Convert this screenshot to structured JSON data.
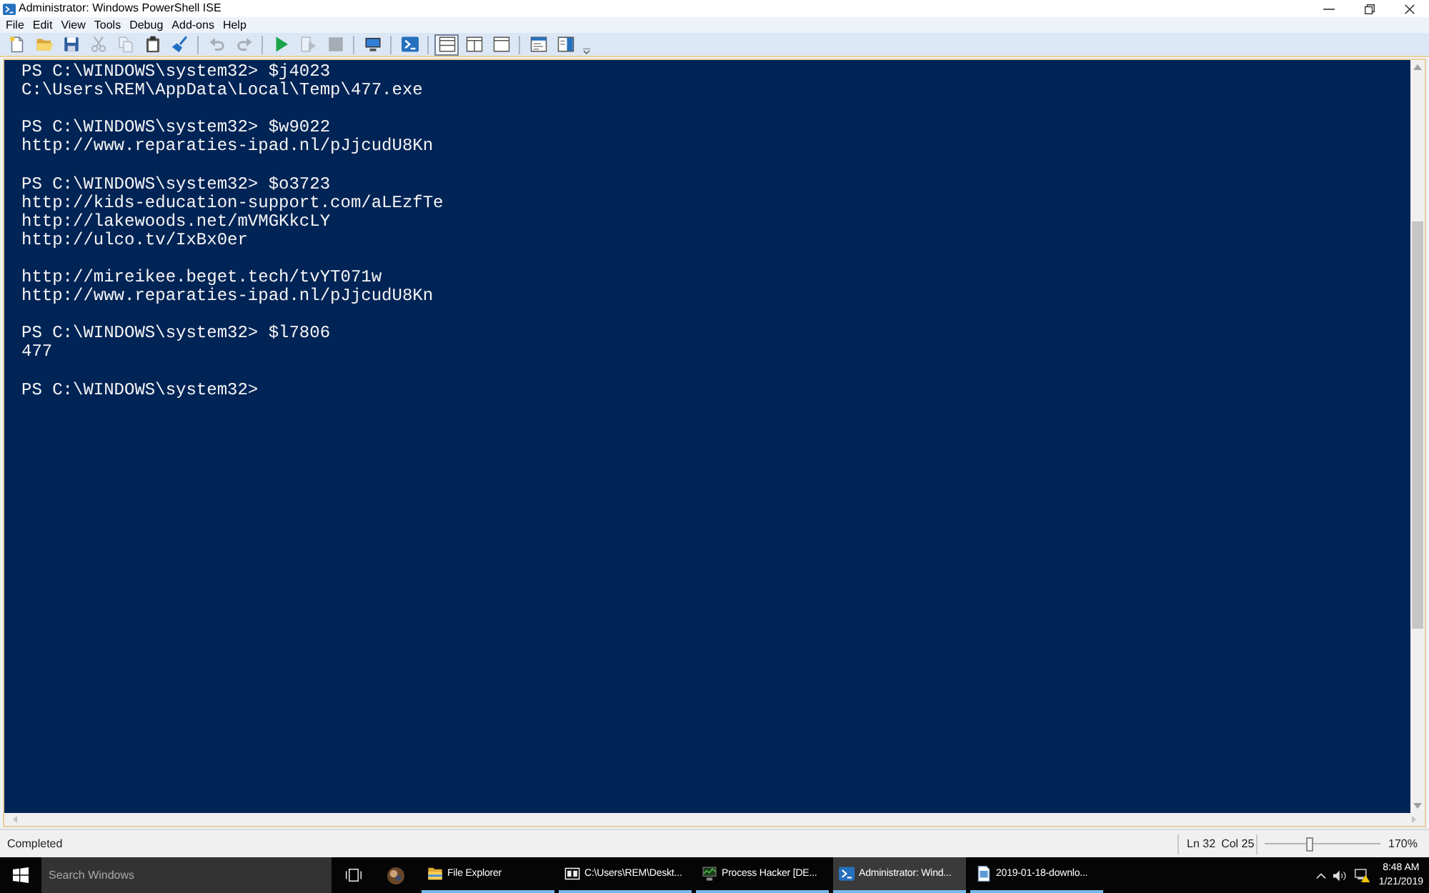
{
  "window": {
    "title": "Administrator: Windows PowerShell ISE"
  },
  "menu": [
    "File",
    "Edit",
    "View",
    "Tools",
    "Debug",
    "Add-ons",
    "Help"
  ],
  "toolbar": {
    "groups": [
      {
        "items": [
          {
            "kind": "new",
            "disabled": false
          },
          {
            "kind": "open",
            "disabled": false
          },
          {
            "kind": "save",
            "disabled": false
          },
          {
            "kind": "cut",
            "disabled": true
          },
          {
            "kind": "copy",
            "disabled": true
          },
          {
            "kind": "paste",
            "disabled": false
          },
          {
            "kind": "clear",
            "disabled": false
          }
        ]
      },
      {
        "items": [
          {
            "kind": "undo",
            "disabled": true
          },
          {
            "kind": "redo",
            "disabled": true
          }
        ]
      },
      {
        "items": [
          {
            "kind": "run",
            "disabled": false
          },
          {
            "kind": "run_selection",
            "disabled": true
          },
          {
            "kind": "stop",
            "disabled": true
          }
        ]
      },
      {
        "items": [
          {
            "kind": "remote",
            "disabled": false
          }
        ]
      },
      {
        "items": [
          {
            "kind": "powershell",
            "disabled": false
          }
        ]
      },
      {
        "items": [
          {
            "kind": "pane_top",
            "selected": true
          },
          {
            "kind": "pane_right",
            "selected": false
          },
          {
            "kind": "pane_max",
            "selected": false
          }
        ]
      },
      {
        "items": [
          {
            "kind": "command_window",
            "disabled": false
          },
          {
            "kind": "command_addon",
            "disabled": false
          }
        ]
      }
    ]
  },
  "console": {
    "blocks": [
      {
        "lines": [
          "PS C:\\WINDOWS\\system32> $j4023",
          "C:\\Users\\REM\\AppData\\Local\\Temp\\477.exe"
        ]
      },
      {
        "lines": [
          "PS C:\\WINDOWS\\system32> $w9022",
          "http://www.reparaties-ipad.nl/pJjcudU8Kn"
        ]
      },
      {
        "lines": [
          "PS C:\\WINDOWS\\system32> $o3723",
          "http://kids-education-support.com/aLEzfTe",
          "http://lakewoods.net/mVMGKkcLY",
          "http://ulco.tv/IxBx0er"
        ]
      },
      {
        "lines": [
          "http://mireikee.beget.tech/tvYT071w",
          "http://www.reparaties-ipad.nl/pJjcudU8Kn"
        ]
      },
      {
        "lines": [
          "PS C:\\WINDOWS\\system32> $l7806",
          "477"
        ]
      },
      {
        "lines": [
          "PS C:\\WINDOWS\\system32>"
        ]
      }
    ]
  },
  "status_bar": {
    "message": "Completed",
    "line": "Ln 32",
    "column": "Col 25",
    "zoom": {
      "level": 0.4,
      "reading": "170%"
    }
  },
  "taskbar": {
    "search": {
      "placeholder": "Search Windows"
    },
    "apps": [
      {
        "kind": "explorer",
        "label": "File Explorer",
        "selected": false
      },
      {
        "kind": "archive",
        "label": "C:\\Users\\REM\\Deskt...",
        "selected": false
      },
      {
        "kind": "monitor",
        "label": "Process Hacker [DE...",
        "selected": false
      },
      {
        "kind": "terminal",
        "label": "Administrator: Wind...",
        "selected": true
      },
      {
        "kind": "document",
        "label": "2019-01-18-downlo...",
        "selected": false
      }
    ],
    "clock": {
      "time": "8:48 AM",
      "date": "1/21/2019"
    }
  }
}
